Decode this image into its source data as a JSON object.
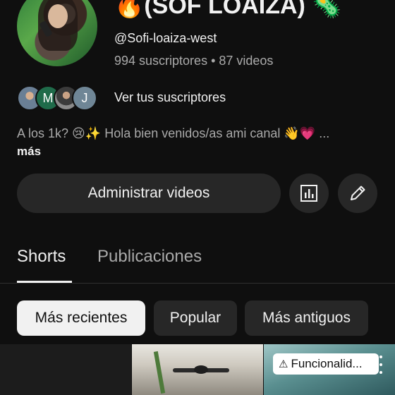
{
  "channel": {
    "title": "🔥(SOF LOAIZA) 🦠",
    "handle": "@Sofi-loaiza-west",
    "stats": "994 suscriptores • 87 videos"
  },
  "subscribers": {
    "avatars": [
      "",
      "M",
      "",
      "J"
    ],
    "link_label": "Ver tus suscriptores"
  },
  "description": {
    "text": "A los 1k? 😢✨  Hola  bien venidos/as ami  canal 👋💗 ...",
    "more_label": "más"
  },
  "actions": {
    "manage_label": "Administrar videos",
    "stats_icon": "bar-chart-icon",
    "edit_icon": "pencil-icon"
  },
  "tabs": [
    {
      "label": "Shorts",
      "active": true
    },
    {
      "label": "Publicaciones",
      "active": false
    }
  ],
  "filters": [
    {
      "label": "Más recientes",
      "selected": true
    },
    {
      "label": "Popular",
      "selected": false
    },
    {
      "label": "Más antiguos",
      "selected": false
    }
  ],
  "thumbnails": {
    "badge_label": "Funcionalid...",
    "badge_icon": "warning-icon"
  }
}
